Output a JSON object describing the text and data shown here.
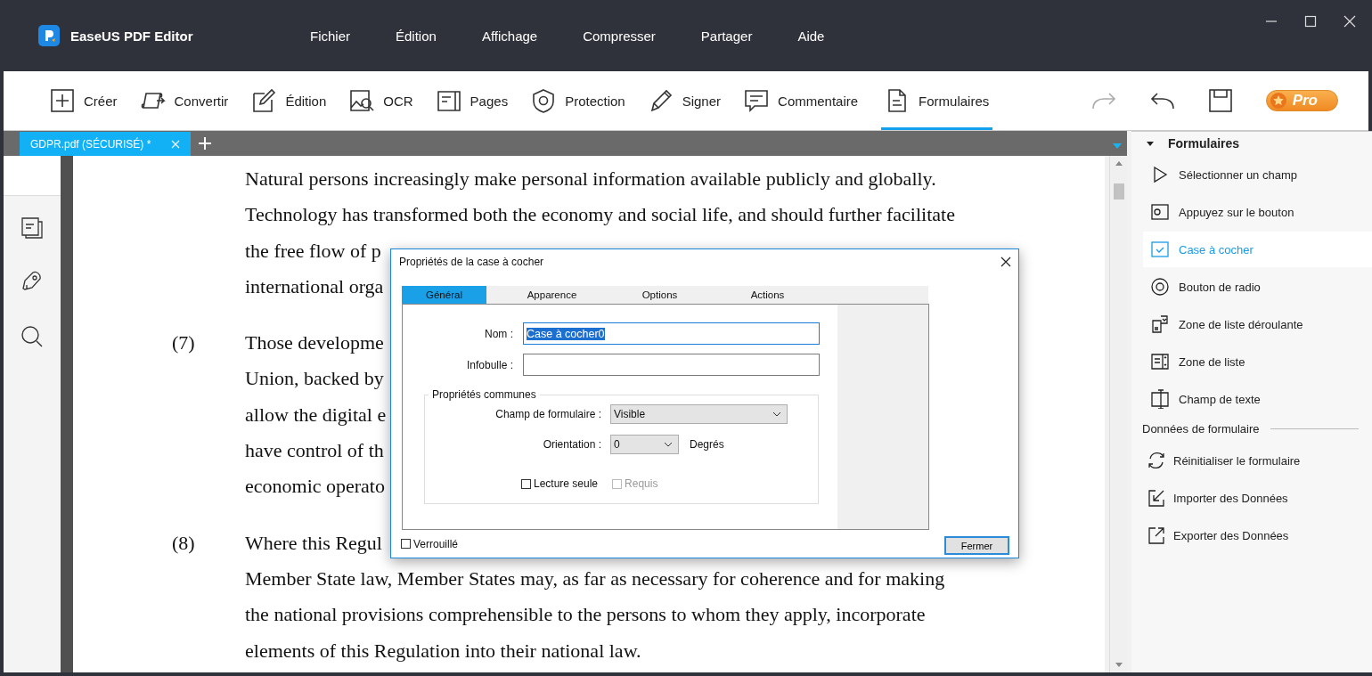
{
  "app": {
    "title": "EaseUS PDF Editor"
  },
  "menu": [
    "Fichier",
    "Édition",
    "Affichage",
    "Compresser",
    "Partager",
    "Aide"
  ],
  "toolbar": [
    {
      "label": "Créer",
      "selected": false
    },
    {
      "label": "Convertir",
      "selected": false
    },
    {
      "label": "Édition",
      "selected": false
    },
    {
      "label": "OCR",
      "selected": false
    },
    {
      "label": "Pages",
      "selected": false
    },
    {
      "label": "Protection",
      "selected": false
    },
    {
      "label": "Signer",
      "selected": false
    },
    {
      "label": "Commentaire",
      "selected": false
    },
    {
      "label": "Formulaires",
      "selected": true
    }
  ],
  "upgrade": {
    "label": "Pro"
  },
  "document_tabs": [
    {
      "label": "GDPR.pdf (SÉCURISÉ) *",
      "selected": true
    }
  ],
  "document": {
    "paragraphs": [
      {
        "lines": [
          "Natural persons increasingly make personal information available publicly and globally.",
          "Technology has transformed both the economy and social life, and should further facilitate",
          "the free flow of p",
          "international orga"
        ]
      },
      {
        "number": "(7)",
        "lines": [
          "Those developme",
          "Union, backed by",
          "allow the digital e",
          "have control of th",
          "economic operato"
        ]
      },
      {
        "number": "(8)",
        "lines": [
          "Where this Regul",
          "Member State law, Member States may, as far as necessary for coherence and for making",
          "the national provisions comprehensible to the persons to whom they apply, incorporate",
          "elements of this Regulation into their national law."
        ]
      }
    ]
  },
  "dialog": {
    "title": "Propriétés de la case à cocher",
    "tabs": [
      {
        "label": "Général",
        "selected": true
      },
      {
        "label": "Apparence",
        "selected": false
      },
      {
        "label": "Options",
        "selected": false
      },
      {
        "label": "Actions",
        "selected": false
      }
    ],
    "name_label": "Nom :",
    "name_value": "Case à cocher0",
    "tooltip_label": "Infobulle :",
    "group": {
      "title": "Propriétés communes",
      "form_field_label": "Champ de formulaire :",
      "form_field_value": "Visible",
      "orientation_label": "Orientation :",
      "orientation_value": "0",
      "orientation_unit": "Degrés"
    },
    "checkboxes": [
      {
        "label": "Lecture seule",
        "checked": false,
        "disabled": false
      },
      {
        "label": "Requis",
        "checked": false,
        "disabled": true
      }
    ],
    "locked": {
      "label": "Verrouillé",
      "checked": false
    },
    "close_button": "Fermer"
  },
  "panel": {
    "forms": {
      "title": "Formulaires",
      "expanded": true,
      "items": [
        {
          "label": "Sélectionner un champ",
          "selected": false
        },
        {
          "label": "Appuyez sur le bouton",
          "selected": false
        },
        {
          "label": "Case à cocher",
          "selected": true
        },
        {
          "label": "Bouton de radio",
          "selected": false
        },
        {
          "label": "Zone de liste déroulante",
          "selected": false
        },
        {
          "label": "Zone de liste",
          "selected": false
        },
        {
          "label": "Champ de texte",
          "selected": false
        }
      ]
    },
    "form_data": {
      "title": "Données de formulaire",
      "items": [
        {
          "label": "Réinitialiser le formulaire",
          "selected": false
        },
        {
          "label": "Importer des Données",
          "selected": false
        },
        {
          "label": "Exporter des Données",
          "selected": false
        }
      ]
    }
  }
}
